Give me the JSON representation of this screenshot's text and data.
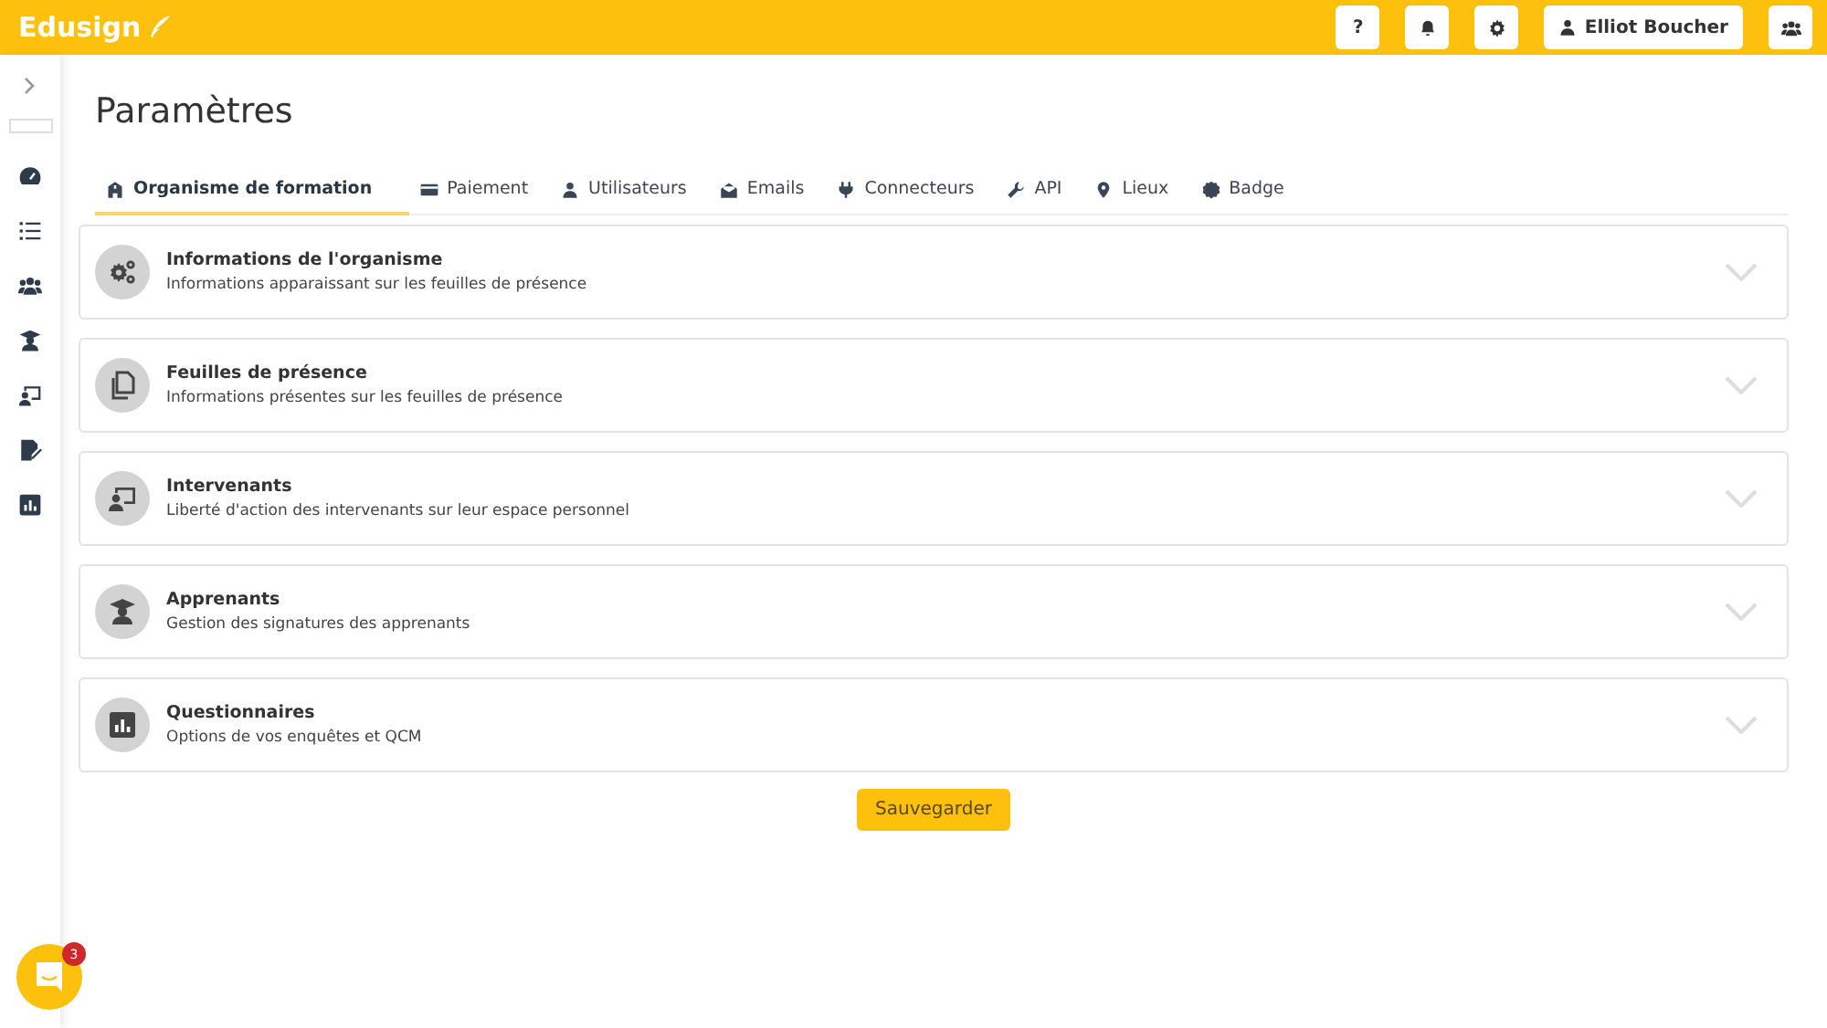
{
  "header": {
    "logo": "Edusign",
    "buttons": [
      {
        "kind": "help",
        "label": "?"
      },
      {
        "kind": "bell"
      },
      {
        "kind": "gear"
      },
      {
        "kind": "user",
        "label": "Elliot Boucher"
      },
      {
        "kind": "team"
      }
    ]
  },
  "sidebar": {
    "items": [
      {
        "kind": "gauge"
      },
      {
        "kind": "list"
      },
      {
        "kind": "team"
      },
      {
        "kind": "student"
      },
      {
        "kind": "teacher"
      },
      {
        "kind": "sign"
      },
      {
        "kind": "chart"
      }
    ]
  },
  "page": {
    "title": "Paramètres"
  },
  "tabs": [
    {
      "label": "Organisme de formation",
      "kind": "building",
      "selected": true
    },
    {
      "label": "Paiement",
      "kind": "card",
      "selected": false
    },
    {
      "label": "Utilisateurs",
      "kind": "user",
      "selected": false
    },
    {
      "label": "Emails",
      "kind": "mail",
      "selected": false
    },
    {
      "label": "Connecteurs",
      "kind": "plug",
      "selected": false
    },
    {
      "label": "API",
      "kind": "wrench",
      "selected": false
    },
    {
      "label": "Lieux",
      "kind": "pin",
      "selected": false
    },
    {
      "label": "Badge",
      "kind": "badge",
      "selected": false
    }
  ],
  "sections": [
    {
      "kind": "gears",
      "title": "Informations de l'organisme",
      "subtitle": "Informations apparaissant sur les feuilles de présence",
      "expanded": false
    },
    {
      "kind": "copy",
      "title": "Feuilles de présence",
      "subtitle": "Informations présentes sur les feuilles de présence",
      "expanded": false
    },
    {
      "kind": "teacher",
      "title": "Intervenants",
      "subtitle": "Liberté d'action des intervenants sur leur espace personnel",
      "expanded": false
    },
    {
      "kind": "student",
      "title": "Apprenants",
      "subtitle": "Gestion des signatures des apprenants",
      "expanded": false
    },
    {
      "kind": "chart",
      "title": "Questionnaires",
      "subtitle": "Options de vos enquêtes et QCM",
      "expanded": false
    }
  ],
  "save_button": "Sauvegarder",
  "chat": {
    "badge": "3"
  }
}
